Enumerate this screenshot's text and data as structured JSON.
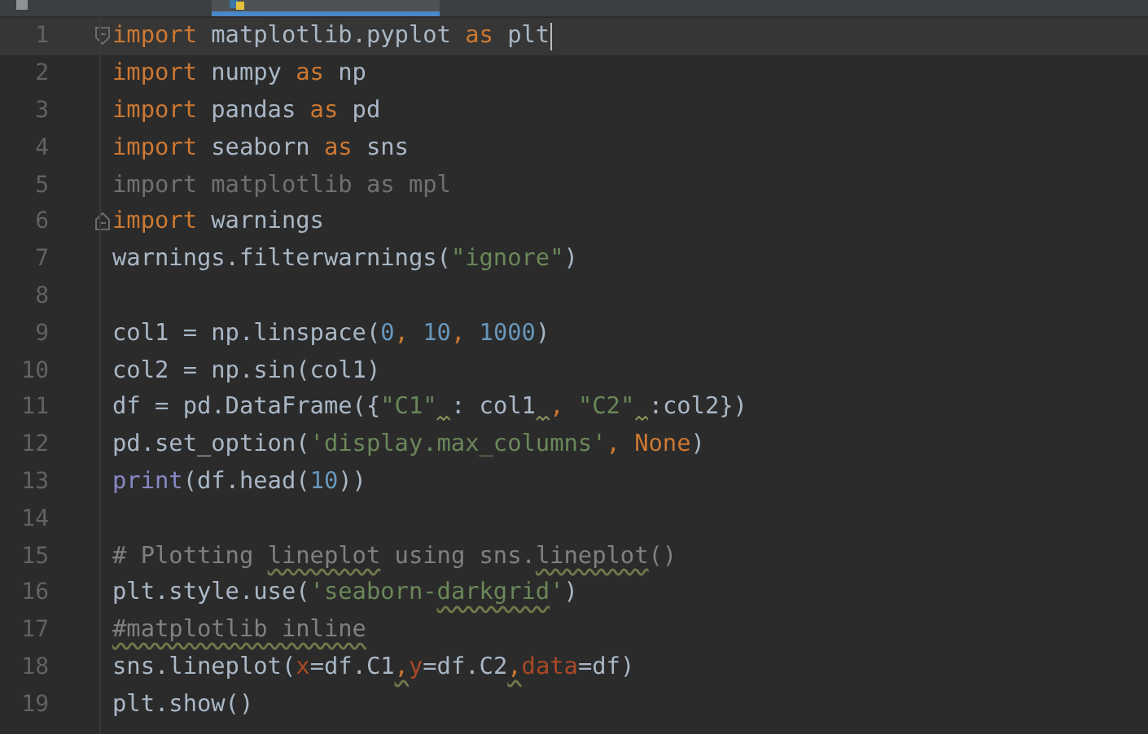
{
  "tabs": [
    {
      "selected": false,
      "kind": "csv"
    },
    {
      "selected": true,
      "kind": "python"
    }
  ],
  "lines": [
    {
      "number": "1",
      "current": true,
      "fold_start": true,
      "caret": true,
      "tokens": [
        {
          "kind": "kw",
          "text": "import"
        },
        {
          "kind": "plain",
          "text": " matplotlib.pyplot "
        },
        {
          "kind": "kw",
          "text": "as"
        },
        {
          "kind": "plain",
          "text": " plt"
        }
      ]
    },
    {
      "number": "2",
      "tokens": [
        {
          "kind": "kw",
          "text": "import"
        },
        {
          "kind": "plain",
          "text": " numpy "
        },
        {
          "kind": "kw",
          "text": "as"
        },
        {
          "kind": "plain",
          "text": " np"
        }
      ]
    },
    {
      "number": "3",
      "tokens": [
        {
          "kind": "kw",
          "text": "import"
        },
        {
          "kind": "plain",
          "text": " pandas "
        },
        {
          "kind": "kw",
          "text": "as"
        },
        {
          "kind": "plain",
          "text": " pd"
        }
      ]
    },
    {
      "number": "4",
      "tokens": [
        {
          "kind": "kw",
          "text": "import"
        },
        {
          "kind": "plain",
          "text": " seaborn "
        },
        {
          "kind": "kw",
          "text": "as"
        },
        {
          "kind": "plain",
          "text": " sns"
        }
      ]
    },
    {
      "number": "5",
      "tokens": [
        {
          "kind": "unused",
          "text": "import matplotlib as mpl"
        }
      ]
    },
    {
      "number": "6",
      "fold_end": true,
      "tokens": [
        {
          "kind": "kw",
          "text": "import"
        },
        {
          "kind": "plain",
          "text": " warnings"
        }
      ]
    },
    {
      "number": "7",
      "tokens": [
        {
          "kind": "plain",
          "text": "warnings.filterwarnings("
        },
        {
          "kind": "str",
          "text": "\"ignore\""
        },
        {
          "kind": "plain",
          "text": ")"
        }
      ]
    },
    {
      "number": "8"
    },
    {
      "number": "9",
      "tokens": [
        {
          "kind": "plain",
          "text": "col1 = np.linspace("
        },
        {
          "kind": "num",
          "text": "0"
        },
        {
          "kind": "kw",
          "text": ", "
        },
        {
          "kind": "num",
          "text": "10"
        },
        {
          "kind": "kw",
          "text": ", "
        },
        {
          "kind": "num",
          "text": "1000"
        },
        {
          "kind": "plain",
          "text": ")"
        }
      ]
    },
    {
      "number": "10",
      "tokens": [
        {
          "kind": "plain",
          "text": "col2 = np.sin(col1)"
        }
      ]
    },
    {
      "number": "11",
      "tokens": [
        {
          "kind": "plain",
          "text": "df = pd.DataFrame({"
        },
        {
          "kind": "str",
          "text": "\"C1\""
        },
        {
          "kind": "plain",
          "text": ": col1",
          "hint_before": true
        },
        {
          "kind": "kw",
          "text": ", ",
          "hint_before": true
        },
        {
          "kind": "str",
          "text": "\"C2\""
        },
        {
          "kind": "plain",
          "text": ":col2})",
          "hint_before": true
        }
      ]
    },
    {
      "number": "12",
      "tokens": [
        {
          "kind": "plain",
          "text": "pd.set_option("
        },
        {
          "kind": "str",
          "text": "'display.max_columns'"
        },
        {
          "kind": "kw",
          "text": ", None"
        },
        {
          "kind": "plain",
          "text": ")"
        }
      ]
    },
    {
      "number": "13",
      "tokens": [
        {
          "kind": "builtin",
          "text": "print"
        },
        {
          "kind": "plain",
          "text": "(df.head("
        },
        {
          "kind": "num",
          "text": "10"
        },
        {
          "kind": "plain",
          "text": "))"
        }
      ]
    },
    {
      "number": "14"
    },
    {
      "number": "15",
      "tokens": [
        {
          "kind": "comment",
          "text": "# Plotting "
        },
        {
          "kind": "comment",
          "text": "lineplot",
          "squiggle": true
        },
        {
          "kind": "comment",
          "text": " using sns."
        },
        {
          "kind": "comment",
          "text": "lineplot",
          "squiggle": true
        },
        {
          "kind": "comment",
          "text": "()"
        }
      ]
    },
    {
      "number": "16",
      "tokens": [
        {
          "kind": "plain",
          "text": "plt.style.use("
        },
        {
          "kind": "str",
          "text": "'seaborn-"
        },
        {
          "kind": "str",
          "text": "darkgrid",
          "squiggle": true
        },
        {
          "kind": "str",
          "text": "'"
        },
        {
          "kind": "plain",
          "text": ")"
        }
      ]
    },
    {
      "number": "17",
      "tokens": [
        {
          "kind": "comment",
          "text": "#matplotlib inline",
          "squiggle": true
        }
      ]
    },
    {
      "number": "18",
      "tokens": [
        {
          "kind": "plain",
          "text": "sns.lineplot("
        },
        {
          "kind": "param",
          "text": "x"
        },
        {
          "kind": "plain",
          "text": "=df.C1"
        },
        {
          "kind": "kw",
          "text": ",",
          "squiggle": true
        },
        {
          "kind": "param",
          "text": "y"
        },
        {
          "kind": "plain",
          "text": "=df.C2"
        },
        {
          "kind": "kw",
          "text": ",",
          "squiggle": true
        },
        {
          "kind": "param",
          "text": "data"
        },
        {
          "kind": "plain",
          "text": "=df)"
        }
      ]
    },
    {
      "number": "19",
      "tokens": [
        {
          "kind": "plain",
          "text": "plt.show()"
        }
      ]
    }
  ]
}
